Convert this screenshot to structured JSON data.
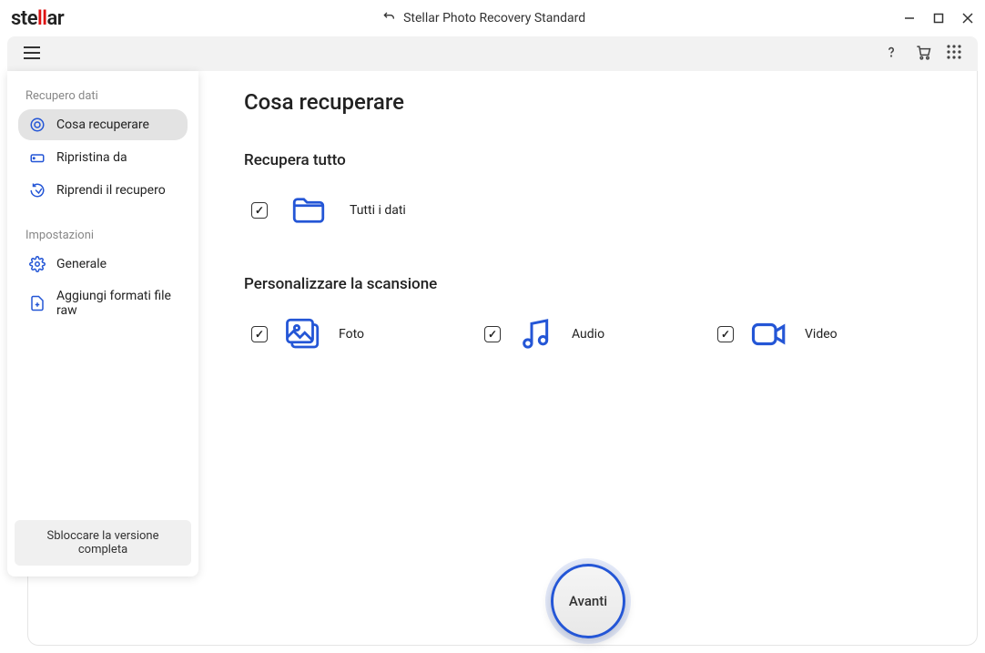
{
  "logo_parts": {
    "pre": "ste",
    "red": "ll",
    "post": "ar"
  },
  "titlebar": {
    "product": "Stellar Photo Recovery Standard"
  },
  "sidebar": {
    "section1_title": "Recupero dati",
    "items1": [
      {
        "label": "Cosa recuperare"
      },
      {
        "label": "Ripristina da"
      },
      {
        "label": "Riprendi il recupero"
      }
    ],
    "section2_title": "Impostazioni",
    "items2": [
      {
        "label": "Generale"
      },
      {
        "label": "Aggiungi formati file raw"
      }
    ],
    "unlock_label": "Sbloccare la versione completa"
  },
  "main": {
    "heading": "Cosa recuperare",
    "recover_all_heading": "Recupera tutto",
    "all_data_label": "Tutti i dati",
    "customize_heading": "Personalizzare la scansione",
    "types": {
      "photo": "Foto",
      "audio": "Audio",
      "video": "Video"
    },
    "next_label": "Avanti"
  }
}
